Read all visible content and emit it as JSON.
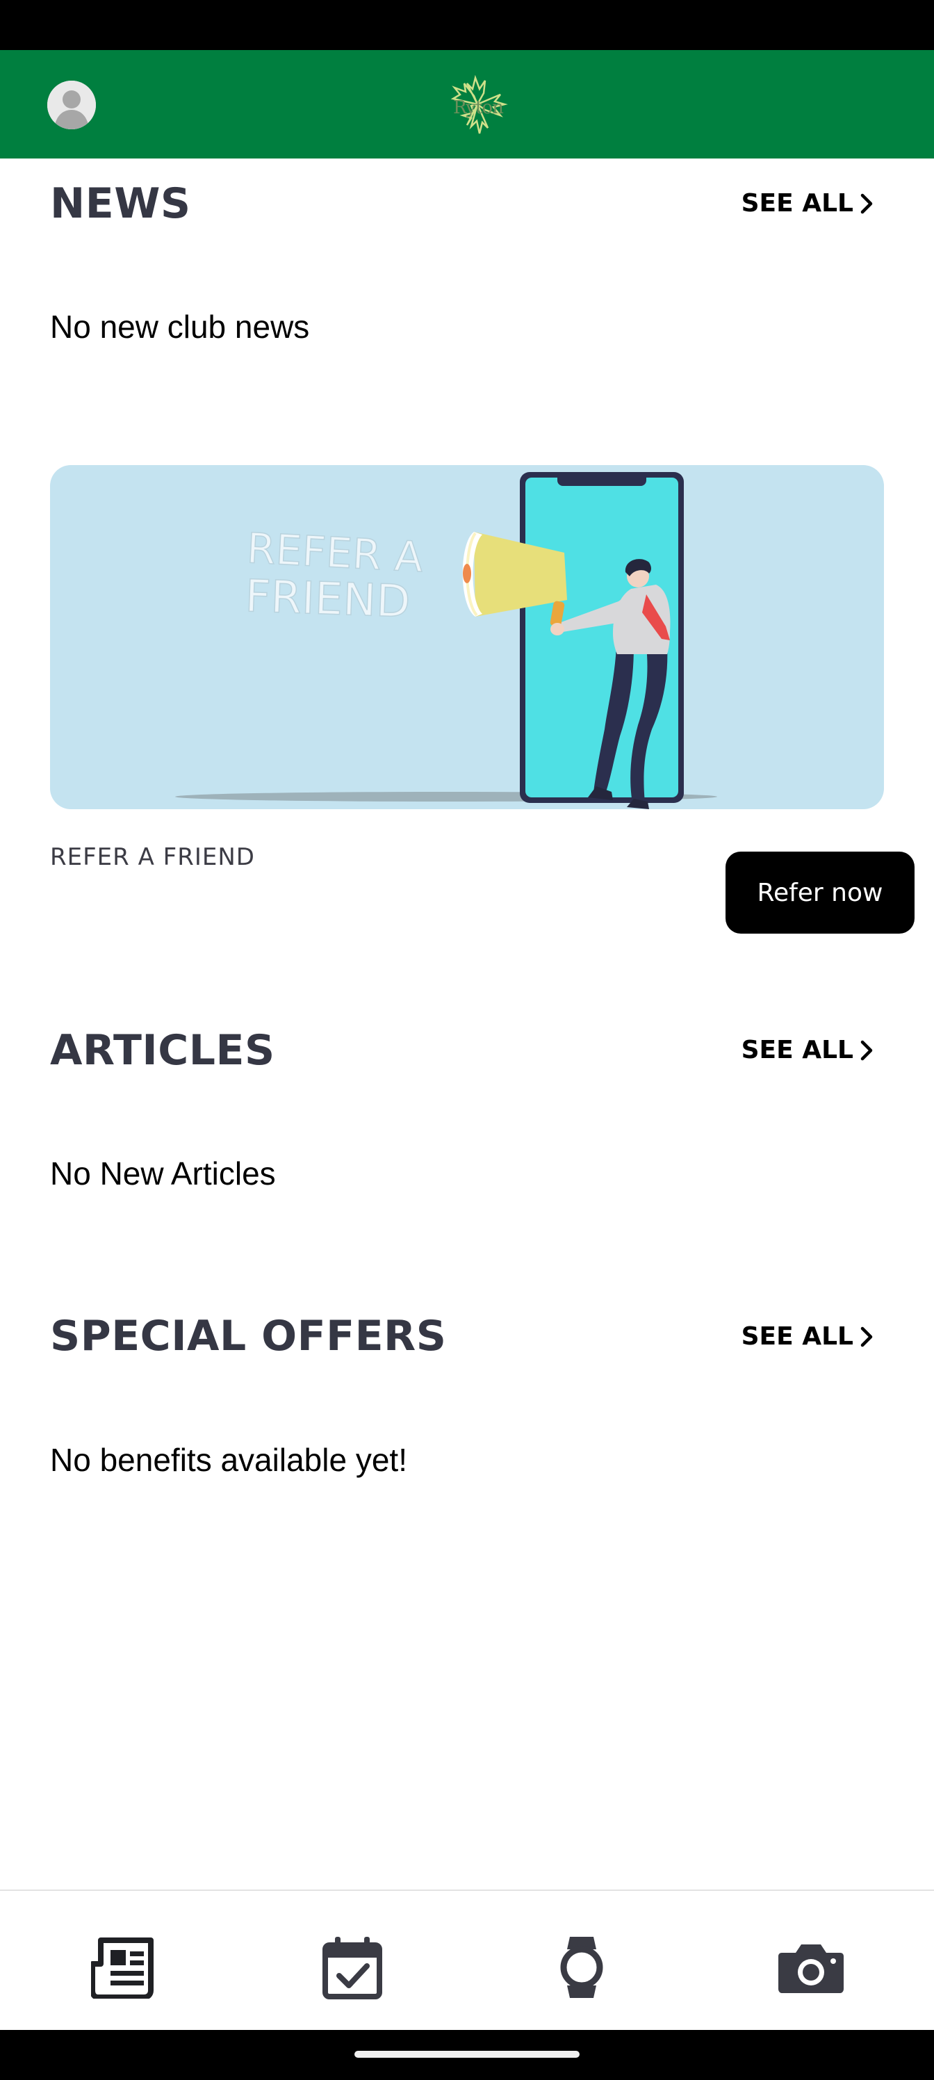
{
  "header": {
    "logo_text": "Ryton",
    "brand_color": "#007F3F",
    "avatar_icon": "user-silhouette-icon"
  },
  "news": {
    "title": "NEWS",
    "see_all": "SEE ALL",
    "empty": "No new club news"
  },
  "refer": {
    "banner_headline_line1": "REFER A",
    "banner_headline_line2": "FRIEND",
    "caption": "REFER A FRIEND",
    "button": "Refer now"
  },
  "articles": {
    "title": "ARTICLES",
    "see_all": "SEE ALL",
    "empty": "No New Articles"
  },
  "offers": {
    "title": "SPECIAL OFFERS",
    "see_all": "SEE ALL",
    "empty": "No benefits available yet!"
  },
  "bottom_nav": {
    "items": [
      {
        "icon": "newspaper-icon",
        "active": true
      },
      {
        "icon": "calendar-check-icon",
        "active": false
      },
      {
        "icon": "watch-icon",
        "active": false
      },
      {
        "icon": "camera-icon",
        "active": false
      }
    ],
    "active_color": "#1f2024",
    "inactive_color": "#3a3b44"
  }
}
